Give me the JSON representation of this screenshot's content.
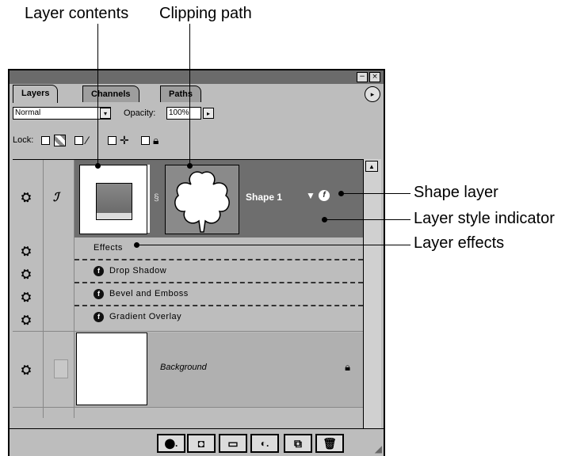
{
  "callouts": {
    "layer_contents": "Layer contents",
    "clipping_path": "Clipping path",
    "shape_layer": "Shape layer",
    "layer_style_indicator": "Layer style indicator",
    "layer_effects": "Layer effects"
  },
  "window": {
    "minimize_glyph": "−",
    "close_glyph": "×"
  },
  "tabs": [
    {
      "label": "Layers",
      "active": true
    },
    {
      "label": "Channels",
      "active": false
    },
    {
      "label": "Paths",
      "active": false
    }
  ],
  "menu_glyph": "▸",
  "blend": {
    "mode": "Normal",
    "dropdown_glyph": "▾",
    "opacity_label": "Opacity:",
    "opacity_value": "100%",
    "opacity_arrow": "▸"
  },
  "lock": {
    "label": "Lock:"
  },
  "layers": {
    "shape_layer_name": "Shape 1",
    "effects_label": "Effects",
    "effects": [
      "Drop Shadow",
      "Bevel and Emboss",
      "Gradient Overlay"
    ],
    "background_name": "Background",
    "fx_glyph": "f"
  },
  "colors": {
    "panel_bg": "#bdbdbd",
    "selected_row": "#6e6e6e",
    "titlebar": "#6b6b6b"
  }
}
